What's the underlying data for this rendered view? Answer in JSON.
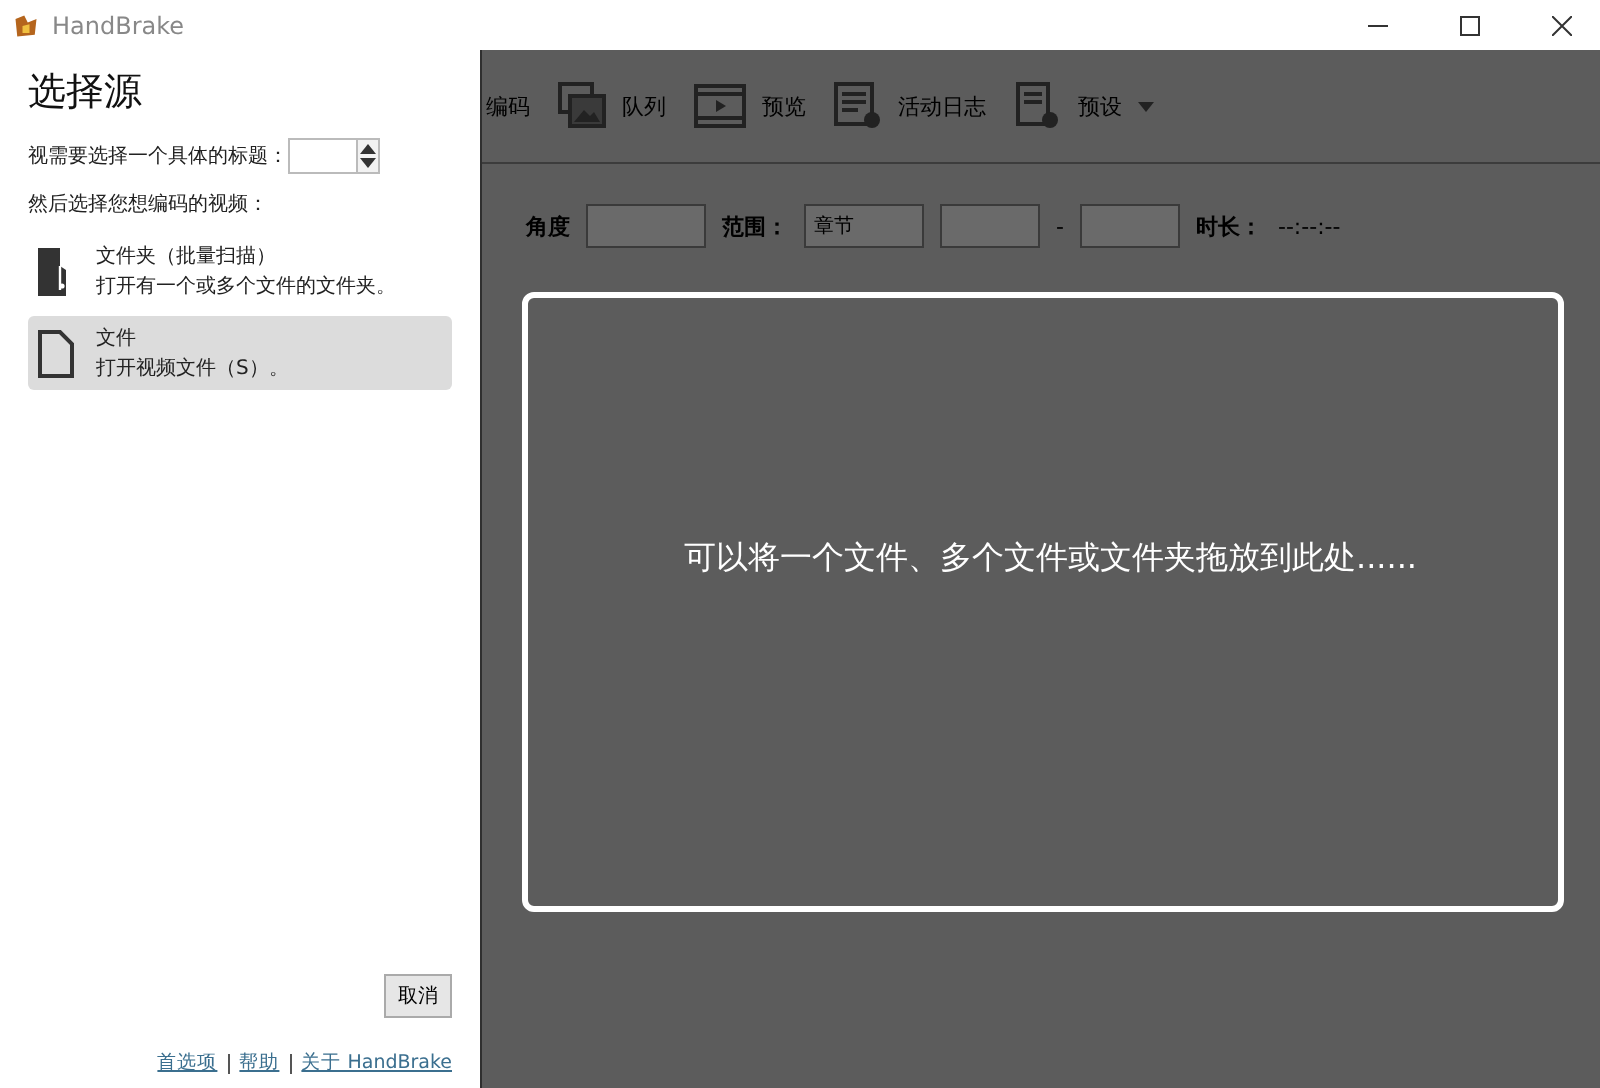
{
  "window": {
    "title": "HandBrake"
  },
  "source_panel": {
    "heading": "选择源",
    "title_prompt": "视需要选择一个具体的标题：",
    "video_prompt": "然后选择您想编码的视频：",
    "options": [
      {
        "kind": "folder",
        "title": "文件夹（批量扫描）",
        "description": "打开有一个或多个文件的文件夹。",
        "selected": false
      },
      {
        "kind": "file",
        "title": "文件",
        "description": "打开视频文件（S）。",
        "selected": true
      }
    ],
    "cancel_button": "取消",
    "links": [
      "首选项",
      "帮助",
      "关于 HandBrake"
    ]
  },
  "toolbar": [
    {
      "kind": "none",
      "label": "编码"
    },
    {
      "kind": "images",
      "label": "队列"
    },
    {
      "kind": "film",
      "label": "预览"
    },
    {
      "kind": "log",
      "label": "活动日志"
    },
    {
      "kind": "preset",
      "label": "预设",
      "dropdown": true
    }
  ],
  "source_row": {
    "angle_label": "角度",
    "range_label": "范围：",
    "range_value": "章节",
    "dash": "-",
    "duration_label": "时长：",
    "duration_value": "--:--:--"
  },
  "drop_zone": {
    "message": "可以将一个文件、多个文件或文件夹拖放到此处......"
  }
}
